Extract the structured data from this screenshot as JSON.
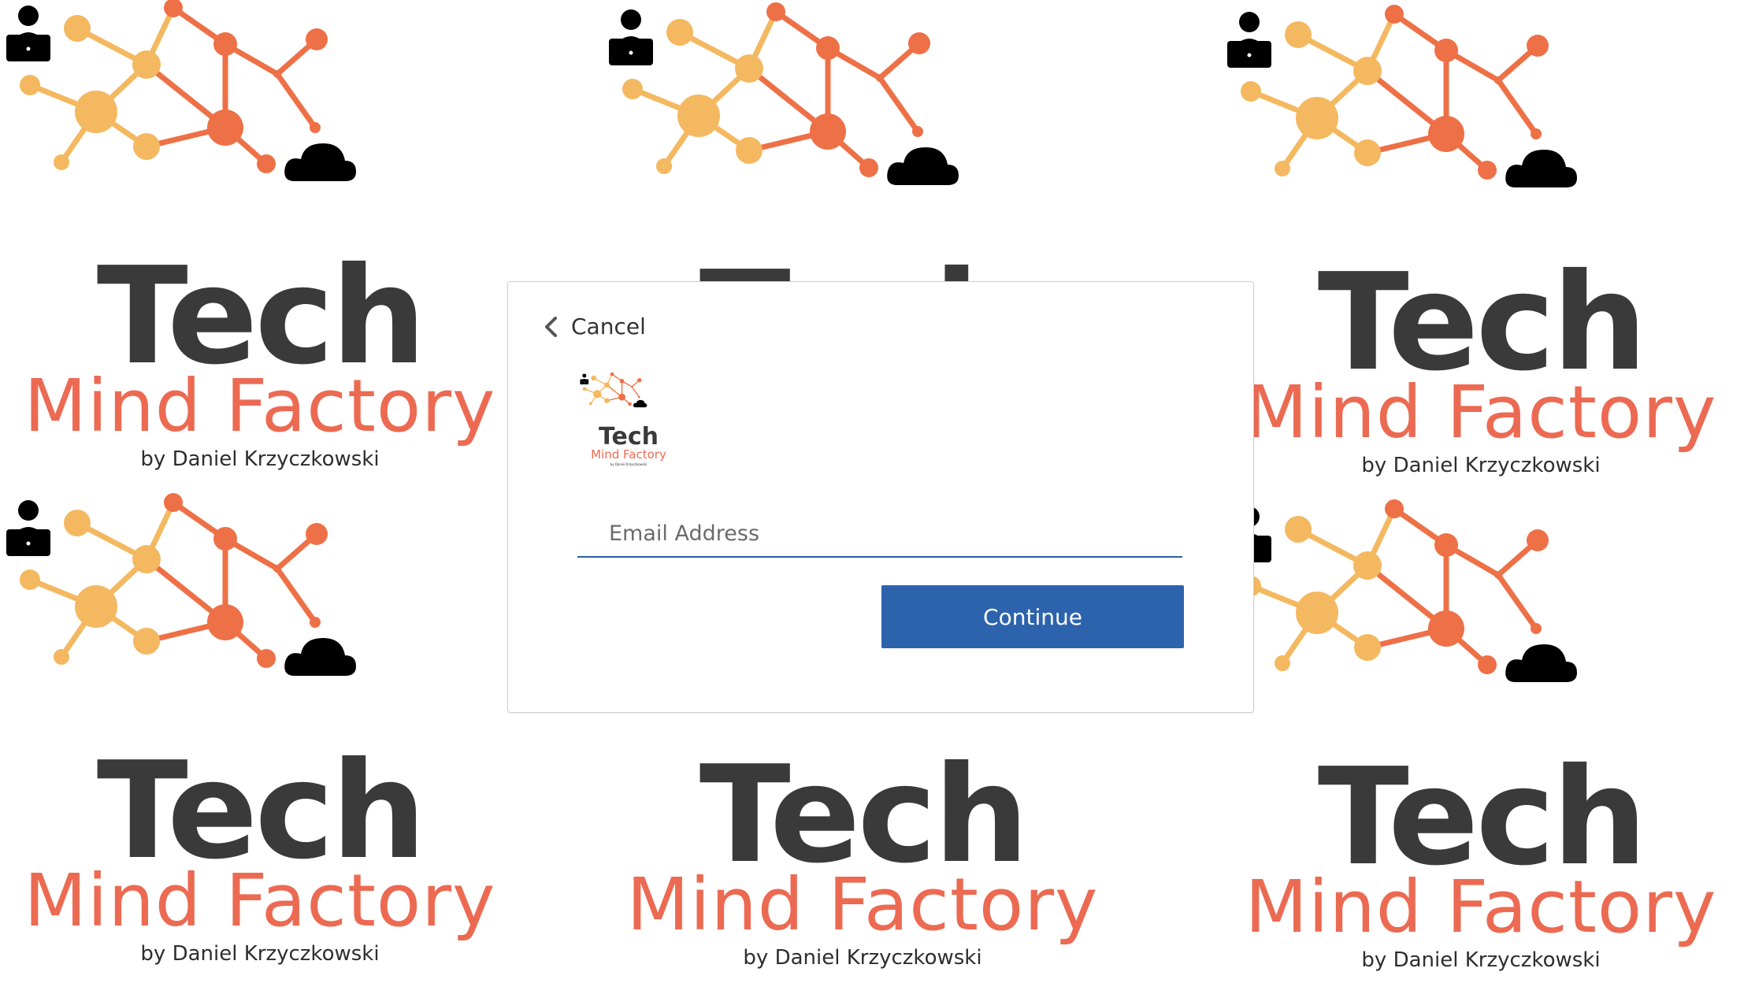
{
  "brand": {
    "title": "Tech",
    "subtitle": "Mind Factory",
    "byline": "by Daniel Krzyczkowski",
    "colors": {
      "dark": "#3a3a3a",
      "accent": "#ec6a52",
      "node_light": "#f4b860",
      "node_dark": "#ee7046"
    }
  },
  "dialog": {
    "cancel_label": "Cancel",
    "cancel_icon": "chevron-left-icon",
    "email_placeholder": "Email Address",
    "email_value": "",
    "continue_label": "Continue",
    "continue_color": "#2d63ad"
  }
}
